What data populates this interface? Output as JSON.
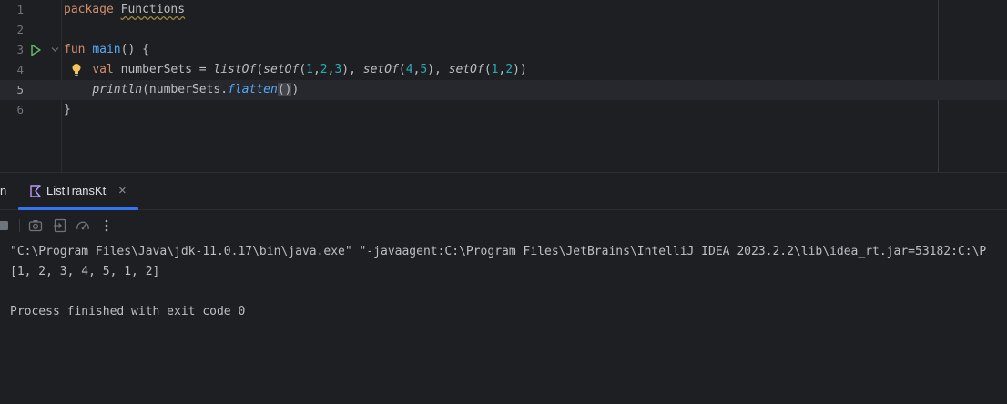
{
  "editor": {
    "lines": [
      {
        "number": "1",
        "parts": [
          {
            "t": "package",
            "c": "kw"
          },
          {
            "t": " "
          },
          {
            "t": "Functions",
            "c": "warn"
          }
        ]
      },
      {
        "number": "2",
        "parts": []
      },
      {
        "number": "3",
        "parts": [
          {
            "t": "fun",
            "c": "kw"
          },
          {
            "t": " "
          },
          {
            "t": "main",
            "c": "fn-decl"
          },
          {
            "t": "() {"
          }
        ]
      },
      {
        "number": "4",
        "parts": [
          {
            "t": "    "
          },
          {
            "t": "val",
            "c": "kw"
          },
          {
            "t": " numberSets = "
          },
          {
            "t": "listOf",
            "c": "ital-plain"
          },
          {
            "t": "("
          },
          {
            "t": "setOf",
            "c": "ital-plain"
          },
          {
            "t": "("
          },
          {
            "t": "1",
            "c": "num"
          },
          {
            "t": ","
          },
          {
            "t": "2",
            "c": "num"
          },
          {
            "t": ","
          },
          {
            "t": "3",
            "c": "num"
          },
          {
            "t": "), "
          },
          {
            "t": "setOf",
            "c": "ital-plain"
          },
          {
            "t": "("
          },
          {
            "t": "4",
            "c": "num"
          },
          {
            "t": ","
          },
          {
            "t": "5",
            "c": "num"
          },
          {
            "t": "), "
          },
          {
            "t": "setOf",
            "c": "ital-plain"
          },
          {
            "t": "("
          },
          {
            "t": "1",
            "c": "num"
          },
          {
            "t": ","
          },
          {
            "t": "2",
            "c": "num"
          },
          {
            "t": "))"
          }
        ]
      },
      {
        "number": "5",
        "parts": [
          {
            "t": "    "
          },
          {
            "t": "println",
            "c": "ital-plain"
          },
          {
            "t": "(numberSets."
          },
          {
            "t": "flatten",
            "c": "ital"
          },
          {
            "t": "()",
            "c": "caret-box"
          },
          {
            "t": ")"
          }
        ]
      },
      {
        "number": "6",
        "parts": [
          {
            "t": "}"
          }
        ]
      }
    ],
    "current_line": "5"
  },
  "run_panel": {
    "partial_tab_label": "n",
    "active_tab": {
      "label": "ListTransKt",
      "close": "×"
    },
    "console_lines": [
      "\"C:\\Program Files\\Java\\jdk-11.0.17\\bin\\java.exe\" \"-javaagent:C:\\Program Files\\JetBrains\\IntelliJ IDEA 2023.2.2\\lib\\idea_rt.jar=53182:C:\\P",
      "[1, 2, 3, 4, 5, 1, 2]",
      "",
      "Process finished with exit code 0"
    ]
  },
  "icons": {
    "run": "run-gutter-icon",
    "fold": "fold-chevron-icon",
    "bulb": "lightbulb-icon",
    "kotlin": "kotlin-file-icon",
    "stop": "stop-icon",
    "camera": "screenshot-icon",
    "restore": "restore-layout-icon",
    "profiler": "profiler-icon",
    "more": "more-vertical-icon"
  },
  "colors": {
    "background": "#1e1f22",
    "keyword": "#cf8e6d",
    "function": "#56a8f5",
    "number": "#2aacb8",
    "run_icon": "#5fb865",
    "accent": "#3574f0"
  }
}
